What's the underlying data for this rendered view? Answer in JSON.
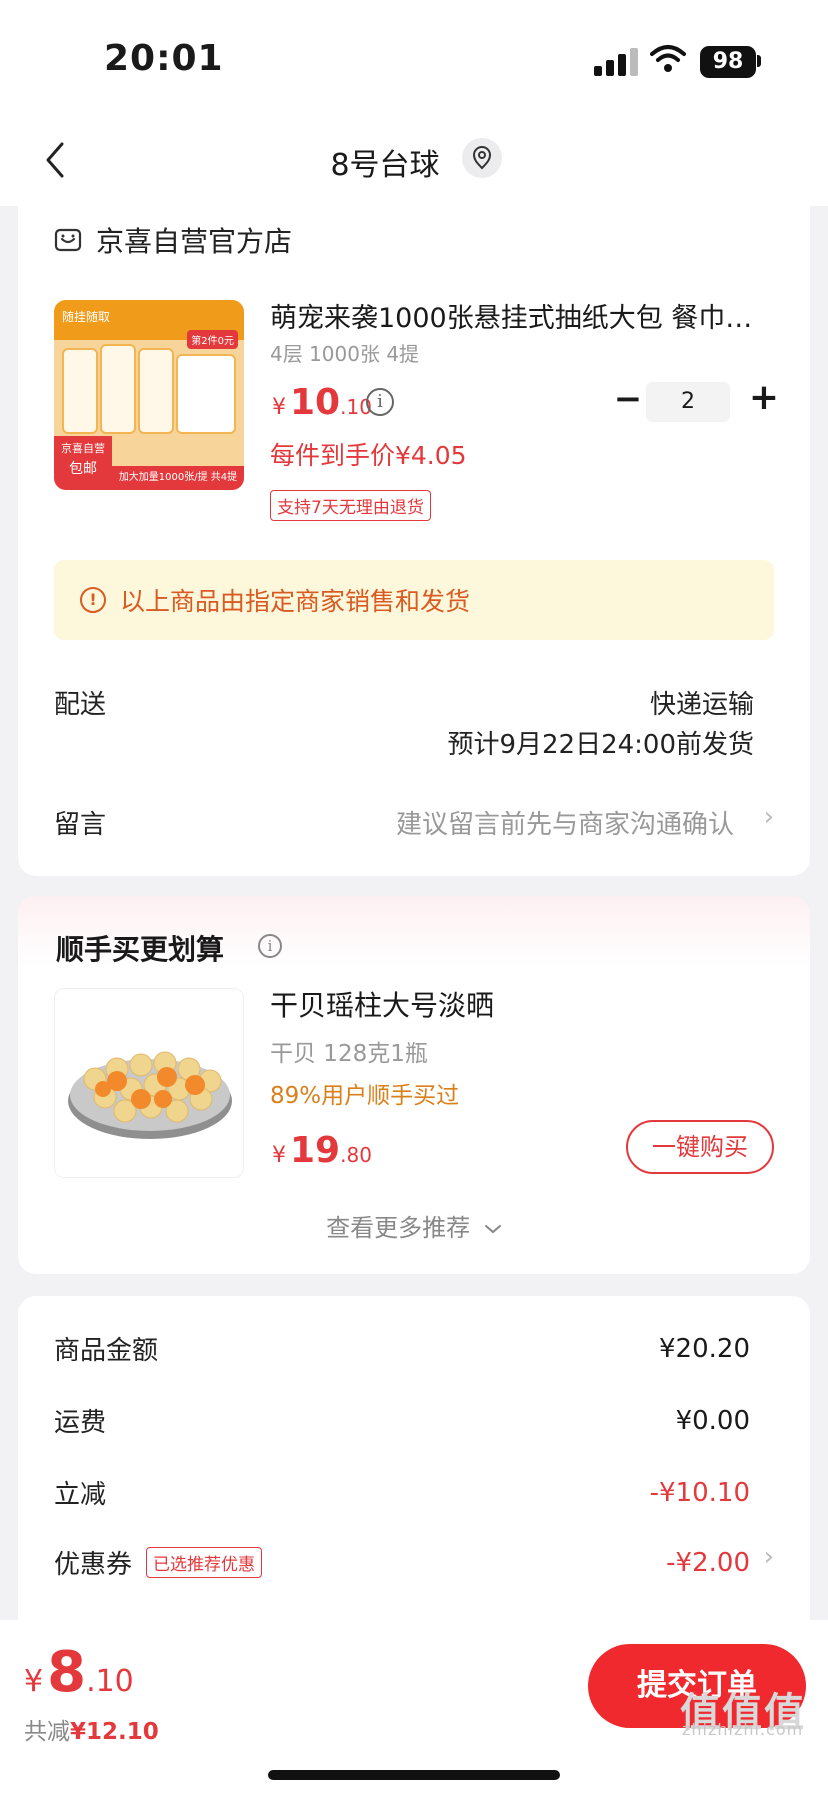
{
  "status": {
    "time": "20:01",
    "battery": "98"
  },
  "nav": {
    "title": "8号台球"
  },
  "shop": {
    "name": "京喜自营官方店"
  },
  "product": {
    "title": "萌宠来袭1000张悬挂式抽纸大包 餐巾…",
    "spec": "4层 1000张 4提",
    "price_symbol": "¥",
    "price_int": "10",
    "price_dec": ".10",
    "quantity": "2",
    "unit_price": "每件到手价¥4.05",
    "return_policy": "支持7天无理由退货",
    "thumb_band_text": "随挂随取",
    "thumb_tag_line1": "京喜自营",
    "thumb_tag_line2": "包邮",
    "thumb_badge": "第2件0元",
    "thumb_footer": "加大加量1000张/提 共4提"
  },
  "notice": {
    "text": "以上商品由指定商家销售和发货"
  },
  "delivery": {
    "label": "配送",
    "method": "快递运输",
    "eta": "预计9月22日24:00前发货"
  },
  "message": {
    "label": "留言",
    "placeholder": "建议留言前先与商家沟通确认"
  },
  "recommend": {
    "title": "顺手买更划算",
    "item_name": "干贝瑶柱大号淡晒",
    "item_spec": "干贝 128克1瓶",
    "item_stat": "89%用户顺手买过",
    "price_symbol": "¥",
    "price_int": "19",
    "price_dec": ".80",
    "buy_label": "一键购买",
    "more_label": "查看更多推荐"
  },
  "summary": {
    "goods_label": "商品金额",
    "goods_value": "¥20.20",
    "shipping_label": "运费",
    "shipping_value": "¥0.00",
    "discount_label": "立减",
    "discount_value": "-¥10.10",
    "coupon_label": "优惠券",
    "coupon_tag": "已选推荐优惠",
    "coupon_value": "-¥2.00"
  },
  "footer": {
    "total_symbol": "¥",
    "total_int": "8",
    "total_dec": ".10",
    "saved_label": "共减",
    "saved_value": "¥12.10",
    "submit_label": "提交订单",
    "watermark": "zhizhizhi.com",
    "watermark_logo": "值值值"
  },
  "colors": {
    "accent": "#e4393c",
    "notice_bg": "#fdf8dc",
    "notice_text": "#d95a22",
    "stat_orange": "#d9801a"
  }
}
